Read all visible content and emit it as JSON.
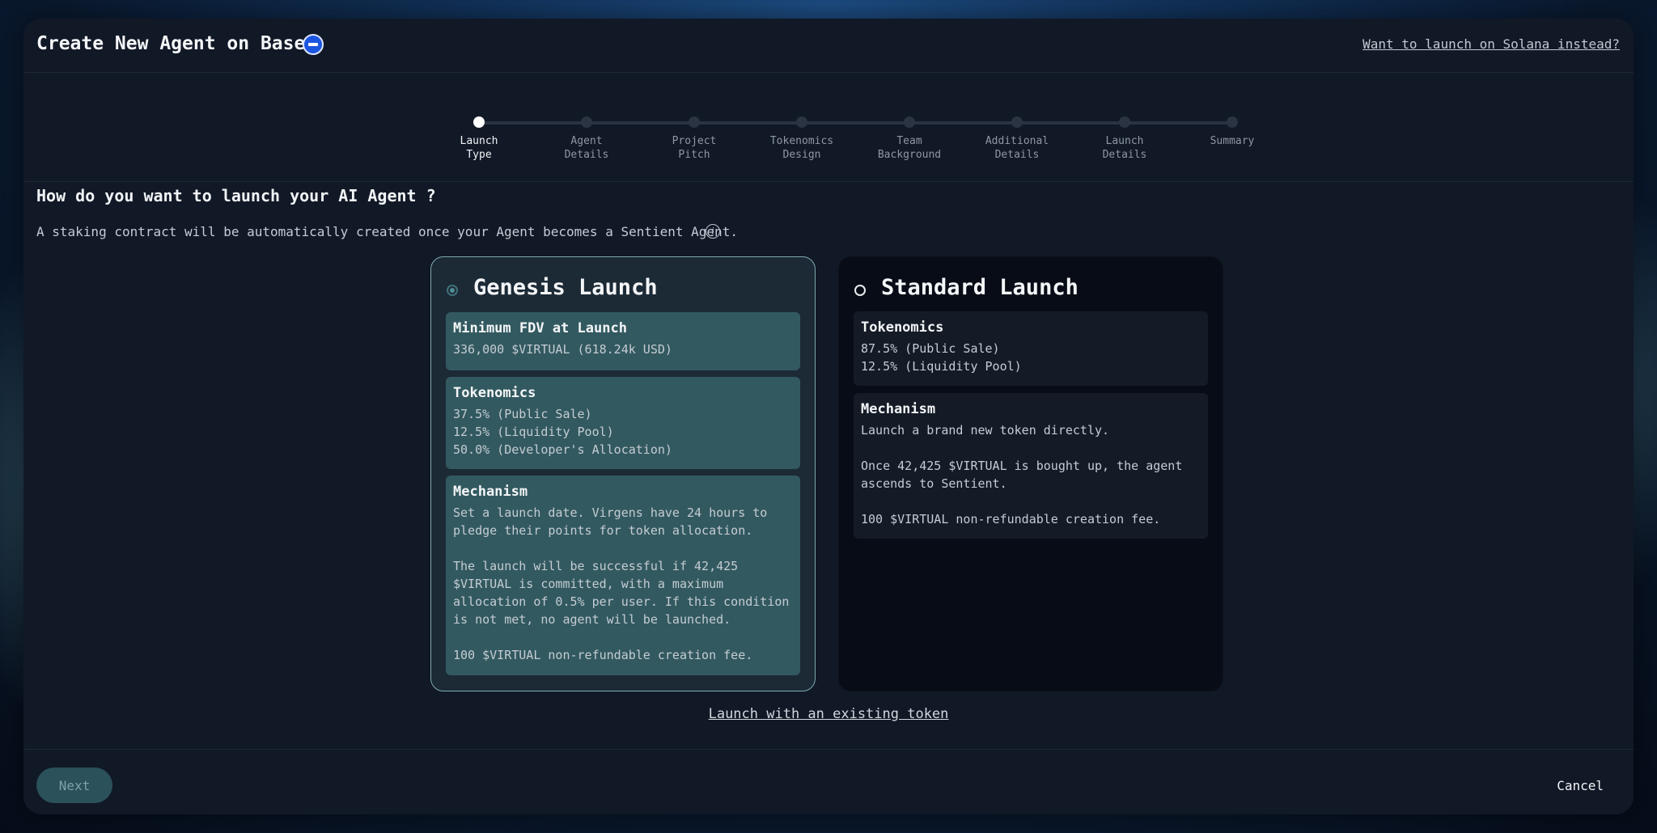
{
  "header": {
    "title": "Create New Agent on Base",
    "logo_icon": "base-network-icon",
    "solana_link": "Want to launch on Solana instead?"
  },
  "stepper": {
    "active_index": 0,
    "steps": [
      {
        "label": "Launch\nType"
      },
      {
        "label": "Agent\nDetails"
      },
      {
        "label": "Project\nPitch"
      },
      {
        "label": "Tokenomics\nDesign"
      },
      {
        "label": "Team\nBackground"
      },
      {
        "label": "Additional\nDetails"
      },
      {
        "label": "Launch\nDetails"
      },
      {
        "label": "Summary"
      }
    ]
  },
  "main": {
    "question": "How do you want to launch your AI Agent ?",
    "subtext": "A staking contract will be automatically created once your Agent becomes a Sentient Agent.",
    "info_icon": "info-icon"
  },
  "genesis": {
    "title": "Genesis Launch",
    "selected": true,
    "fdv": {
      "title": "Minimum FDV at Launch",
      "value": "336,000 $VIRTUAL (618.24k USD)"
    },
    "tokenomics": {
      "title": "Tokenomics",
      "lines": [
        "37.5% (Public Sale)",
        "12.5% (Liquidity Pool)",
        "50.0% (Developer's Allocation)"
      ]
    },
    "mechanism": {
      "title": "Mechanism",
      "p1": "Set a launch date. Virgens have 24 hours to\npledge their points for token allocation.",
      "p2": "The launch will be successful if 42,425\n$VIRTUAL is committed, with a maximum\nallocation of 0.5% per user. If this condition\nis not met, no agent will be launched.",
      "p3": "100 $VIRTUAL non-refundable creation fee."
    }
  },
  "standard": {
    "title": "Standard Launch",
    "selected": false,
    "tokenomics": {
      "title": "Tokenomics",
      "lines": [
        "87.5% (Public Sale)",
        "12.5% (Liquidity Pool)"
      ]
    },
    "mechanism": {
      "title": "Mechanism",
      "p1": "Launch a brand new token directly.",
      "p2": "Once 42,425 $VIRTUAL is bought up, the agent\nascends to Sentient.",
      "p3": "100 $VIRTUAL non-refundable creation fee."
    }
  },
  "existing_token_link": "Launch with an existing token",
  "footer": {
    "next_label": "Next",
    "cancel_label": "Cancel"
  },
  "colors": {
    "accent": "#335960",
    "selected_border": "#7fa9b1",
    "modal_bg": "#111826"
  }
}
